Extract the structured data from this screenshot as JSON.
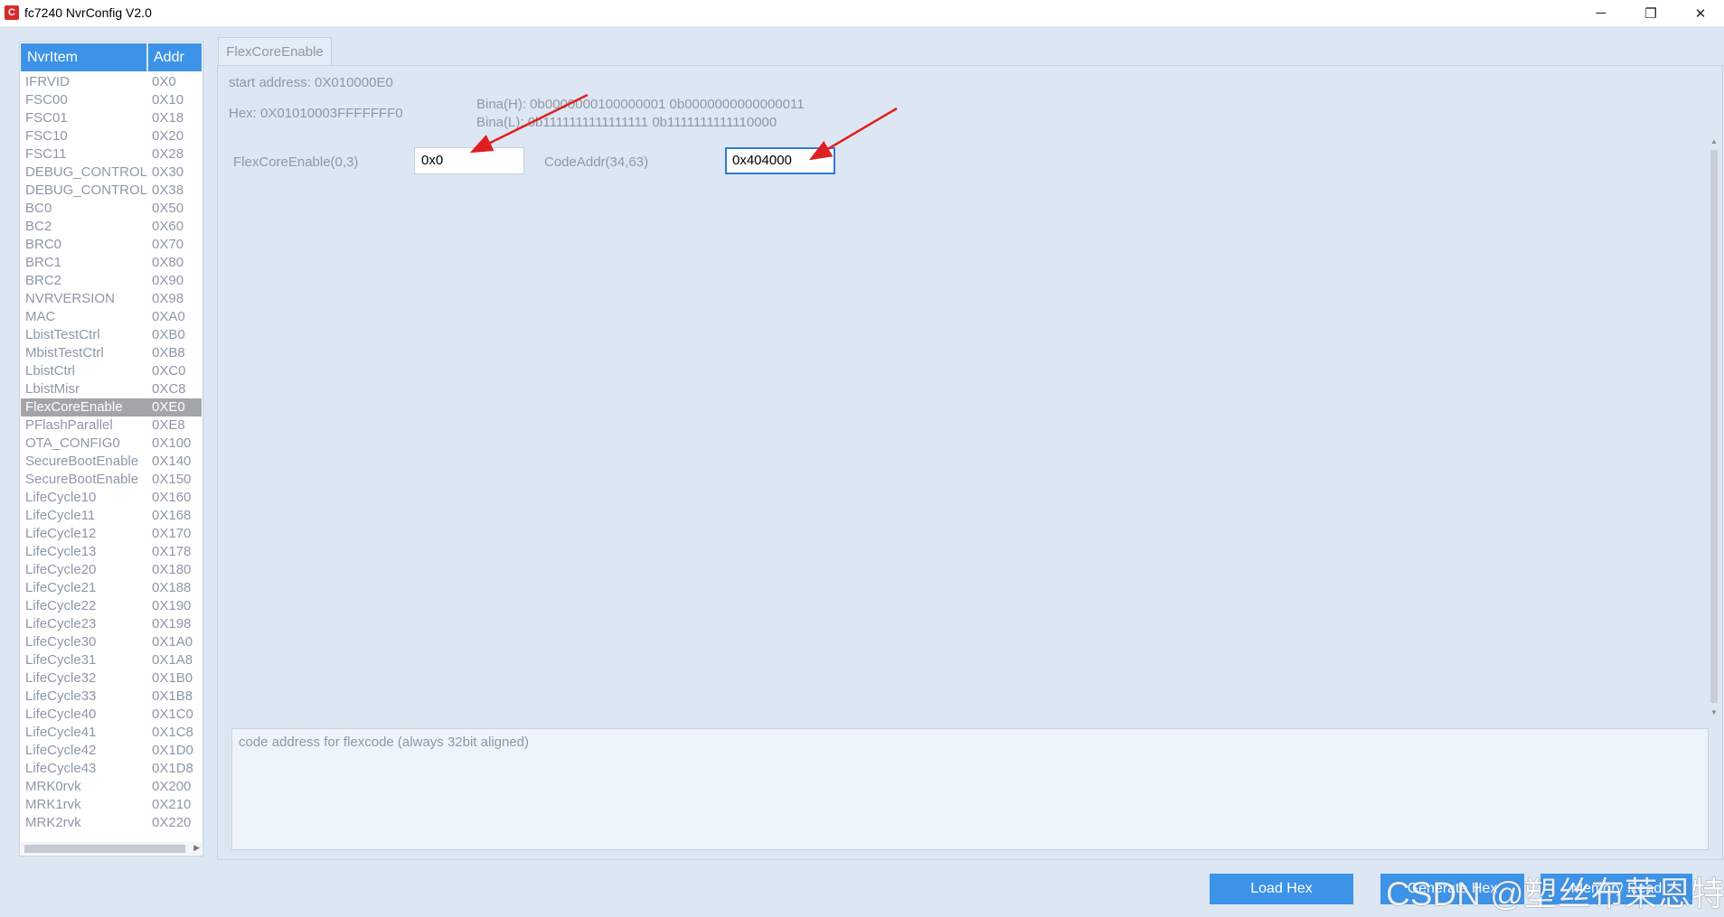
{
  "window": {
    "title": "fc7240 NvrConfig V2.0",
    "icon": "app-logo-icon",
    "controls": {
      "minimize": "─",
      "maximize": "❐",
      "close": "✕"
    }
  },
  "list": {
    "headers": {
      "item": "NvrItem",
      "addr": "Addr"
    },
    "selected_index": 18,
    "rows": [
      {
        "name": "IFRVID",
        "addr": "0X0"
      },
      {
        "name": "FSC00",
        "addr": "0X10"
      },
      {
        "name": "FSC01",
        "addr": "0X18"
      },
      {
        "name": "FSC10",
        "addr": "0X20"
      },
      {
        "name": "FSC11",
        "addr": "0X28"
      },
      {
        "name": "DEBUG_CONTROL",
        "addr": "0X30"
      },
      {
        "name": "DEBUG_CONTROL",
        "addr": "0X38"
      },
      {
        "name": "BC0",
        "addr": "0X50"
      },
      {
        "name": "BC2",
        "addr": "0X60"
      },
      {
        "name": "BRC0",
        "addr": "0X70"
      },
      {
        "name": "BRC1",
        "addr": "0X80"
      },
      {
        "name": "BRC2",
        "addr": "0X90"
      },
      {
        "name": "NVRVERSION",
        "addr": "0X98"
      },
      {
        "name": "MAC",
        "addr": "0XA0"
      },
      {
        "name": "LbistTestCtrl",
        "addr": "0XB0"
      },
      {
        "name": "MbistTestCtrl",
        "addr": "0XB8"
      },
      {
        "name": "LbistCtrl",
        "addr": "0XC0"
      },
      {
        "name": "LbistMisr",
        "addr": "0XC8"
      },
      {
        "name": "FlexCoreEnable",
        "addr": "0XE0"
      },
      {
        "name": "PFlashParallel",
        "addr": "0XE8"
      },
      {
        "name": "OTA_CONFIG0",
        "addr": "0X100"
      },
      {
        "name": "SecureBootEnable",
        "addr": "0X140"
      },
      {
        "name": "SecureBootEnable",
        "addr": "0X150"
      },
      {
        "name": "LifeCycle10",
        "addr": "0X160"
      },
      {
        "name": "LifeCycle11",
        "addr": "0X168"
      },
      {
        "name": "LifeCycle12",
        "addr": "0X170"
      },
      {
        "name": "LifeCycle13",
        "addr": "0X178"
      },
      {
        "name": "LifeCycle20",
        "addr": "0X180"
      },
      {
        "name": "LifeCycle21",
        "addr": "0X188"
      },
      {
        "name": "LifeCycle22",
        "addr": "0X190"
      },
      {
        "name": "LifeCycle23",
        "addr": "0X198"
      },
      {
        "name": "LifeCycle30",
        "addr": "0X1A0"
      },
      {
        "name": "LifeCycle31",
        "addr": "0X1A8"
      },
      {
        "name": "LifeCycle32",
        "addr": "0X1B0"
      },
      {
        "name": "LifeCycle33",
        "addr": "0X1B8"
      },
      {
        "name": "LifeCycle40",
        "addr": "0X1C0"
      },
      {
        "name": "LifeCycle41",
        "addr": "0X1C8"
      },
      {
        "name": "LifeCycle42",
        "addr": "0X1D0"
      },
      {
        "name": "LifeCycle43",
        "addr": "0X1D8"
      },
      {
        "name": "MRK0rvk",
        "addr": "0X200"
      },
      {
        "name": "MRK1rvk",
        "addr": "0X210"
      },
      {
        "name": "MRK2rvk",
        "addr": "0X220"
      }
    ]
  },
  "tab": {
    "label": "FlexCoreEnable"
  },
  "detail": {
    "start_address": "start address: 0X010000E0",
    "hex": "Hex: 0X01010003FFFFFFF0",
    "bina_h": "Bina(H): 0b0000000100000001 0b0000000000000011",
    "bina_l": "Bina(L): 0b1111111111111111 0b1111111111110000",
    "field1": {
      "label": "FlexCoreEnable(0,3)",
      "value": "0x0"
    },
    "field2": {
      "label": "CodeAddr(34,63)",
      "value": "0x404000"
    },
    "description": "code address for flexcode (always 32bit aligned)"
  },
  "buttons": {
    "load_hex": "Load Hex",
    "generate_hex": "Generate Hex",
    "memory_read": "Memory Read"
  },
  "watermark": "CSDN @塑丝布莱恩特",
  "colors": {
    "accent": "#3d93e8",
    "selected_row": "#a3a5a8",
    "annotation_arrow": "#e02020"
  }
}
